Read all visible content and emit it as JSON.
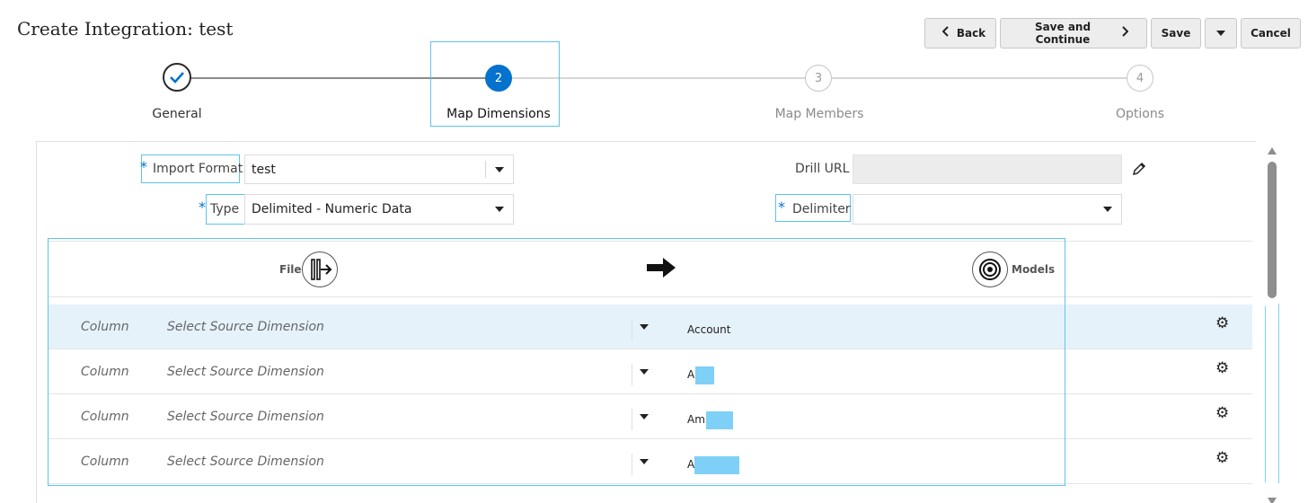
{
  "page": {
    "title": "Create Integration: test"
  },
  "toolbar": {
    "back_label": "Back",
    "save_continue_label": "Save and Continue",
    "save_label": "Save",
    "cancel_label": "Cancel"
  },
  "train": {
    "steps": [
      {
        "number": "",
        "label": "General",
        "state": "completed"
      },
      {
        "number": "2",
        "label": "Map Dimensions",
        "state": "current"
      },
      {
        "number": "3",
        "label": "Map Members",
        "state": "future"
      },
      {
        "number": "4",
        "label": "Options",
        "state": "future"
      }
    ]
  },
  "form": {
    "required_marker": "*",
    "import_format": {
      "label": "Import Format",
      "value": "test"
    },
    "type": {
      "label": "Type",
      "value": "Delimited - Numeric Data"
    },
    "drill_url": {
      "label": "Drill URL",
      "value": ""
    },
    "delimiter": {
      "label": "Delimiter",
      "value": ""
    }
  },
  "mapping": {
    "source_label": "File",
    "target_label": "Models",
    "rows": [
      {
        "type": "Column",
        "source": "Select Source Dimension",
        "target": "Account"
      },
      {
        "type": "Column",
        "source": "Select Source Dimension",
        "target": "A"
      },
      {
        "type": "Column",
        "source": "Select Source Dimension",
        "target": "Am"
      },
      {
        "type": "Column",
        "source": "Select Source Dimension",
        "target": "A"
      }
    ]
  },
  "colors": {
    "accent": "#0572ce",
    "focus_outline": "#5bc4ef",
    "row_highlight": "#e6f2fa",
    "redaction": "#7fd0f6"
  }
}
